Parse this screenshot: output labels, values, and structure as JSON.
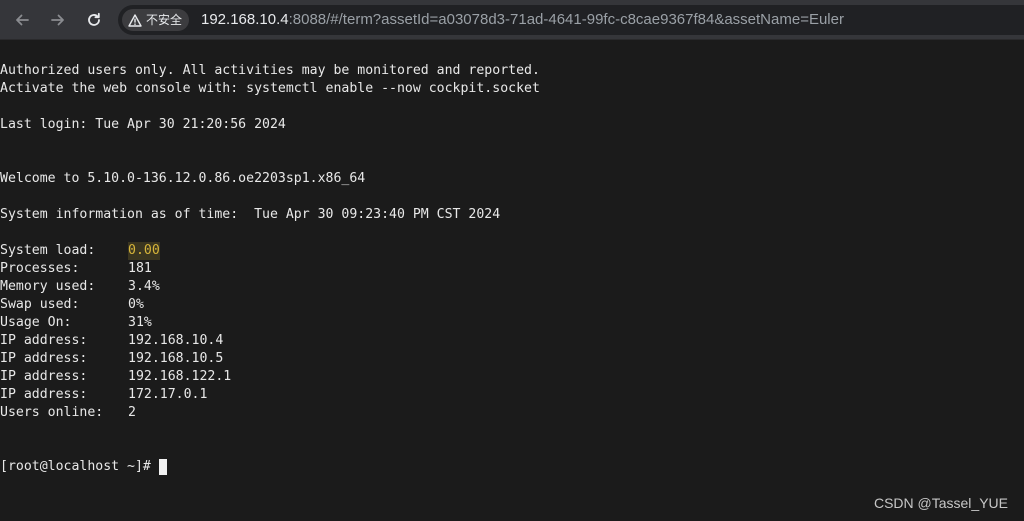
{
  "browser": {
    "security_label": "不安全",
    "url_host": "192.168.10.4",
    "url_rest": ":8088/#/term?assetId=a03078d3-71ad-4641-99fc-c8cae9367f84&assetName=Euler",
    "icons": [
      "back-arrow-icon",
      "forward-arrow-icon",
      "reload-icon",
      "warning-icon"
    ]
  },
  "terminal": {
    "banner_line1": "Authorized users only. All activities may be monitored and reported.",
    "banner_line2": "Activate the web console with: systemctl enable --now cockpit.socket",
    "last_login": "Last login: Tue Apr 30 21:20:56 2024",
    "welcome": "Welcome to 5.10.0-136.12.0.86.oe2203sp1.x86_64",
    "sysinfo": "System information as of time:  Tue Apr 30 09:23:40 PM CST 2024",
    "info": [
      {
        "key": "System load:",
        "value": "0.00"
      },
      {
        "key": "Processes:",
        "value": "181"
      },
      {
        "key": "Memory used:",
        "value": "3.4%"
      },
      {
        "key": "Swap used:",
        "value": "0%"
      },
      {
        "key": "Usage On:",
        "value": "31%"
      },
      {
        "key": "IP address:",
        "value": "192.168.10.4"
      },
      {
        "key": "IP address:",
        "value": "192.168.10.5"
      },
      {
        "key": "IP address:",
        "value": "192.168.122.1"
      },
      {
        "key": "IP address:",
        "value": "172.17.0.1"
      },
      {
        "key": "Users online:",
        "value": "2"
      }
    ],
    "prompt": "[root@localhost ~]#",
    "highlight_color": "#d7b53a"
  },
  "watermark": "CSDN @Tassel_YUE"
}
